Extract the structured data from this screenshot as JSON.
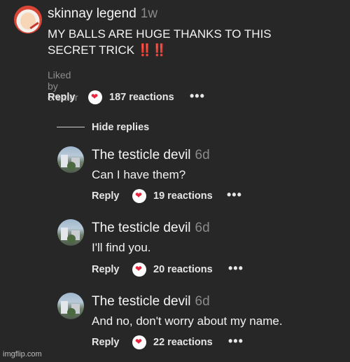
{
  "main_comment": {
    "author": "skinnay legend",
    "time": "1w",
    "text_line1": "MY BALLS ARE HUGE THANKS TO THIS",
    "text_line2": "SECRET TRICK",
    "emoji": "‼️‼️",
    "liked_by": "Liked by creator",
    "reply_label": "Reply",
    "reactions": "187 reactions",
    "more": "•••"
  },
  "hide_replies": "Hide replies",
  "replies": [
    {
      "author": "The testicle devil",
      "time": "6d",
      "text": "Can I have them?",
      "reply_label": "Reply",
      "reactions": "19 reactions",
      "more": "•••"
    },
    {
      "author": "The testicle devil",
      "time": "6d",
      "text": "I'll find you.",
      "reply_label": "Reply",
      "reactions": "20 reactions",
      "more": "•••"
    },
    {
      "author": "The testicle devil",
      "time": "6d",
      "text": "And no, don't worry about my name.",
      "reply_label": "Reply",
      "reactions": "22 reactions",
      "more": "•••"
    }
  ],
  "watermark": "imgflip.com",
  "colors": {
    "background": "#272727",
    "heart": "#e8253d",
    "muted": "#8a8a8a"
  }
}
